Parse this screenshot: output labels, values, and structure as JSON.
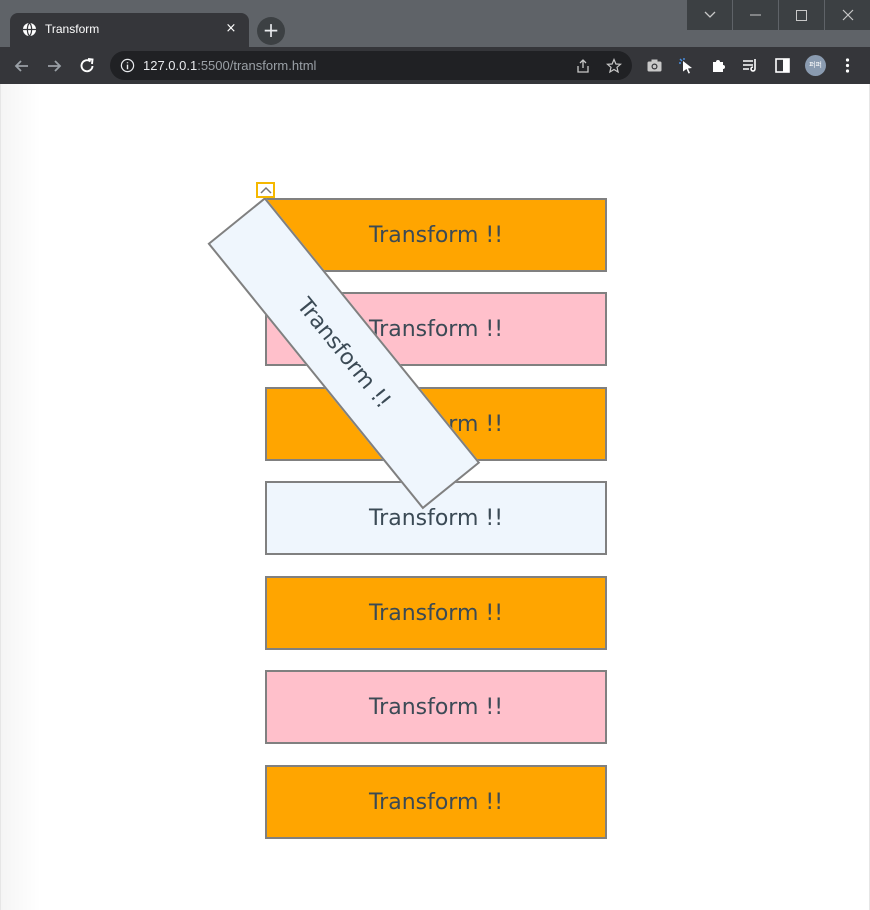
{
  "browser": {
    "tab_title": "Transform",
    "tab_close_label": "×",
    "new_tab_label": "+",
    "url_host": "127.0.0.1",
    "url_rest": ":5500/transform.html",
    "profile_initials": "퍼퍼"
  },
  "colors": {
    "orange": "#ffa500",
    "pink": "#ffc0cb",
    "aliceblue": "#eff6fd"
  },
  "page": {
    "rotated_box": {
      "label": "Transform !!",
      "color": "#eff6fd",
      "rotation_deg": 51
    },
    "boxes": [
      {
        "label": "Transform !!",
        "color": "#ffa500"
      },
      {
        "label": "Transform !!",
        "color": "#ffc0cb"
      },
      {
        "label": "Transform !!",
        "color": "#ffa500"
      },
      {
        "label": "Transform !!",
        "color": "#eff6fd"
      },
      {
        "label": "Transform !!",
        "color": "#ffa500"
      },
      {
        "label": "Transform !!",
        "color": "#ffc0cb"
      },
      {
        "label": "Transform !!",
        "color": "#ffa500"
      }
    ]
  }
}
